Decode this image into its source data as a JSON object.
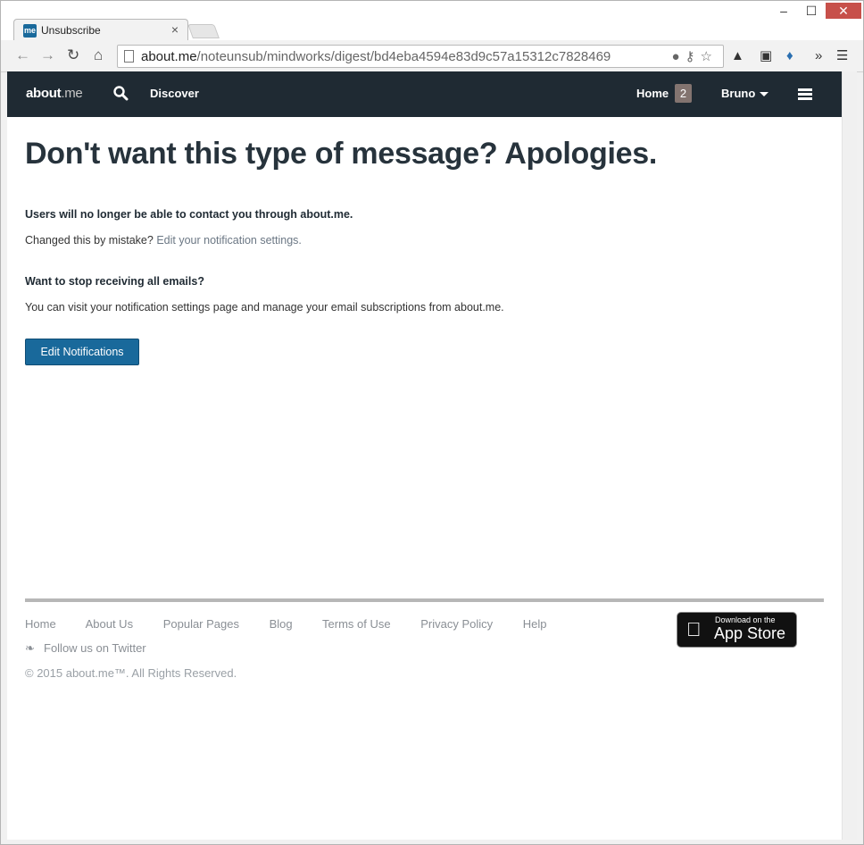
{
  "browser": {
    "tab_favicon": "me",
    "tab_title": "Unsubscribe",
    "tab_close": "×",
    "url_host": "about.me",
    "url_path": "/noteunsub/mindworks/digest/bd4eba4594e83d9c57a15312c7828469",
    "icons": [
      "back-icon",
      "forward-icon",
      "reload-icon",
      "home-icon",
      "page-icon",
      "star-icon",
      "menu-icon"
    ]
  },
  "site_nav": {
    "brand_main": "about",
    "brand_suffix": ".me",
    "discover": "Discover",
    "home": "Home",
    "home_count": "2",
    "user": "Bruno"
  },
  "main": {
    "headline": "Don't want this type of message? Apologies.",
    "notice_bold": "Users will no longer be able to contact you through about.me.",
    "mistake_text": "Changed this by mistake? ",
    "mistake_link": "Edit your notification settings.",
    "stop_bold": "Want to stop receiving all emails?",
    "stop_text": "You can visit your notification settings page and manage your email subscriptions from about.me.",
    "button_label": "Edit Notifications"
  },
  "footer": {
    "links": [
      "Home",
      "About Us",
      "Popular Pages",
      "Blog",
      "Terms of Use",
      "Privacy Policy",
      "Help"
    ],
    "twitter": "Follow us on Twitter",
    "copyright": "© 2015 about.me™. All Rights Reserved.",
    "appstore_small": "Download on the",
    "appstore_big": "App Store"
  },
  "colors": {
    "nav_bg": "#1f2a33",
    "accent": "#19699b",
    "badge": "#837470"
  }
}
